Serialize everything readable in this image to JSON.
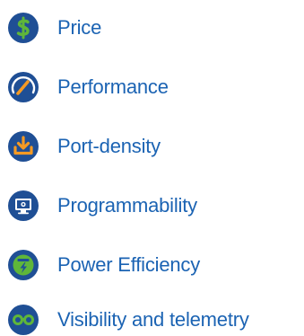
{
  "colors": {
    "text": "#1b63b3",
    "icon_bg": "#1f4f95",
    "accent_orange": "#f59a23",
    "accent_green": "#5fb63a",
    "icon_white": "#ffffff"
  },
  "features": [
    {
      "label": "Price",
      "icon": "dollar-icon"
    },
    {
      "label": "Performance",
      "icon": "speedometer-icon"
    },
    {
      "label": "Port-density",
      "icon": "download-tray-icon"
    },
    {
      "label": "Programmability",
      "icon": "monitor-icon"
    },
    {
      "label": "Power Efficiency",
      "icon": "power-bolt-icon"
    },
    {
      "label": "Visibility and telemetry",
      "icon": "binoculars-icon"
    }
  ]
}
